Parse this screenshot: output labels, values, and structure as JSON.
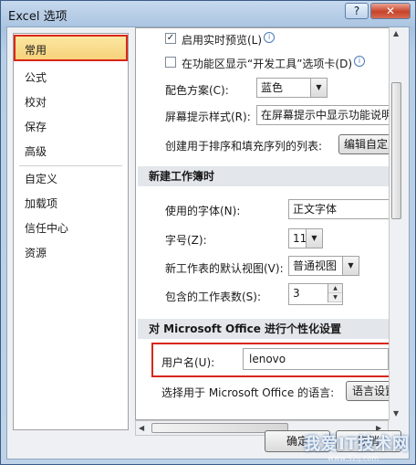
{
  "window": {
    "title": "Excel 选项",
    "help_label": "?",
    "close_label": "✕"
  },
  "sidebar": {
    "items": [
      {
        "label": "常用"
      },
      {
        "label": "公式"
      },
      {
        "label": "校对"
      },
      {
        "label": "保存"
      },
      {
        "label": "高级"
      },
      {
        "label": "自定义"
      },
      {
        "label": "加载项"
      },
      {
        "label": "信任中心"
      },
      {
        "label": "资源"
      }
    ],
    "selected": "常用"
  },
  "options": {
    "live_preview": {
      "label": "启用实时预览(L)",
      "checked": true
    },
    "developer_tab": {
      "label": "在功能区显示“开发工具”选项卡(D)",
      "checked": false
    },
    "color_scheme": {
      "label": "配色方案(C):",
      "value": "蓝色"
    },
    "screentip": {
      "label": "屏幕提示样式(R):",
      "value": "在屏幕提示中显示功能说明"
    },
    "custom_list": {
      "label": "创建用于排序和填充序列的列表:",
      "button": "编辑自定义"
    }
  },
  "new_workbook": {
    "heading": "新建工作簿时",
    "font": {
      "label": "使用的字体(N):",
      "value": "正文字体"
    },
    "size": {
      "label": "字号(Z):",
      "value": "11"
    },
    "view": {
      "label": "新工作表的默认视图(V):",
      "value": "普通视图"
    },
    "sheets": {
      "label": "包含的工作表数(S):",
      "value": "3"
    }
  },
  "personalize": {
    "heading": "对 Microsoft Office 进行个性化设置",
    "username": {
      "label": "用户名(U):",
      "value": "lenovo"
    },
    "language": {
      "label": "选择用于 Microsoft Office 的语言:",
      "button": "语言设置"
    }
  },
  "footer": {
    "ok": "确定",
    "cancel": "取消"
  },
  "watermark": {
    "text": "我爱IT技术网",
    "url": "www.52ij.com"
  },
  "colors": {
    "highlight": "#d8261b",
    "selected_bg": "#f7d27a"
  }
}
